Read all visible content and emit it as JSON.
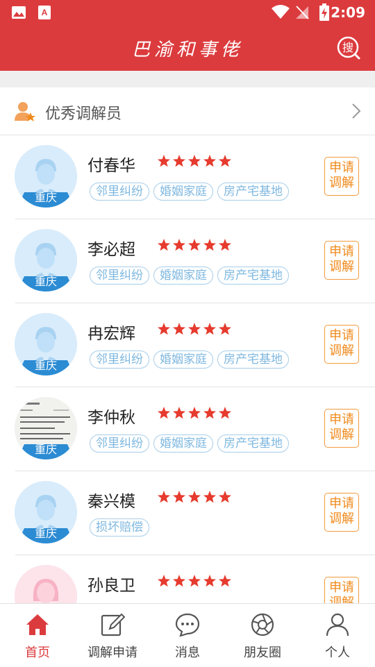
{
  "status_bar": {
    "time": "2:09"
  },
  "header": {
    "title": "巴渝和事佬"
  },
  "section": {
    "title": "优秀调解员"
  },
  "mediators": [
    {
      "name": "付春华",
      "rating": 5,
      "region": "重庆",
      "avatar": "default-male",
      "tags": [
        "邻里纠纷",
        "婚姻家庭",
        "房产宅基地"
      ],
      "action": [
        "申请",
        "调解"
      ]
    },
    {
      "name": "李必超",
      "rating": 5,
      "region": "重庆",
      "avatar": "default-male",
      "tags": [
        "邻里纠纷",
        "婚姻家庭",
        "房产宅基地"
      ],
      "action": [
        "申请",
        "调解"
      ]
    },
    {
      "name": "冉宏辉",
      "rating": 5,
      "region": "重庆",
      "avatar": "default-male",
      "tags": [
        "邻里纠纷",
        "婚姻家庭",
        "房产宅基地"
      ],
      "action": [
        "申请",
        "调解"
      ]
    },
    {
      "name": "李仲秋",
      "rating": 5,
      "region": "重庆",
      "avatar": "screenshot",
      "tags": [
        "邻里纠纷",
        "婚姻家庭",
        "房产宅基地"
      ],
      "action": [
        "申请",
        "调解"
      ]
    },
    {
      "name": "秦兴模",
      "rating": 5,
      "region": "重庆",
      "avatar": "default-male",
      "tags": [
        "损坏赔偿"
      ],
      "action": [
        "申请",
        "调解"
      ]
    },
    {
      "name": "孙良卫",
      "rating": 5,
      "region": "",
      "avatar": "default-female",
      "tags": [],
      "action": [
        "申请",
        "调解"
      ]
    }
  ],
  "tabs": [
    {
      "label": "首页",
      "icon": "home-icon",
      "active": true
    },
    {
      "label": "调解申请",
      "icon": "edit-icon",
      "active": false
    },
    {
      "label": "消息",
      "icon": "message-icon",
      "active": false
    },
    {
      "label": "朋友圈",
      "icon": "aperture-icon",
      "active": false
    },
    {
      "label": "个人",
      "icon": "person-icon",
      "active": false
    }
  ],
  "colors": {
    "primary": "#dc3b3e",
    "tag": "#7fb8e0",
    "accent": "#f08a1c",
    "star": "#e63b2e"
  }
}
